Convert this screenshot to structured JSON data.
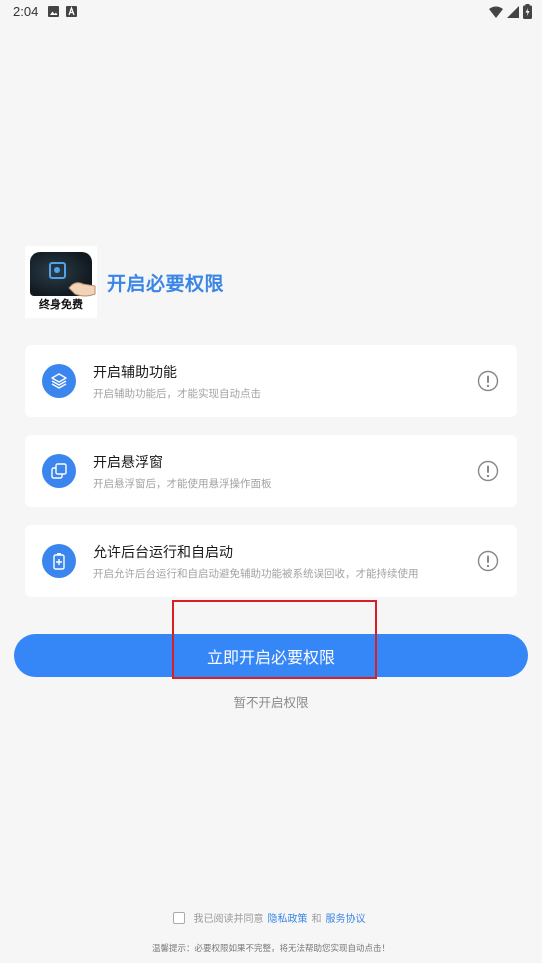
{
  "status_bar": {
    "time": "2:04"
  },
  "header": {
    "logo_caption": "终身免费",
    "title": "开启必要权限"
  },
  "permissions": [
    {
      "icon": "layers-icon",
      "title": "开启辅助功能",
      "desc": "开启辅助功能后，才能实现自动点击"
    },
    {
      "icon": "floating-window-icon",
      "title": "开启悬浮窗",
      "desc": "开启悬浮窗后，才能使用悬浮操作面板"
    },
    {
      "icon": "battery-plus-icon",
      "title": "允许后台运行和自启动",
      "desc": "开启允许后台运行和自启动避免辅助功能被系统误回收，才能持续使用"
    }
  ],
  "actions": {
    "primary": "立即开启必要权限",
    "skip": "暂不开启权限"
  },
  "agreement": {
    "prefix": "我已阅读并同意",
    "privacy": "隐私政策",
    "and": "和",
    "service": "服务协议"
  },
  "footer": {
    "tip": "温馨提示：必要权限如果不完整，将无法帮助您实现自动点击！"
  },
  "colors": {
    "accent": "#3586f6",
    "highlight": "#d81f26",
    "background": "#f6f6f6"
  }
}
